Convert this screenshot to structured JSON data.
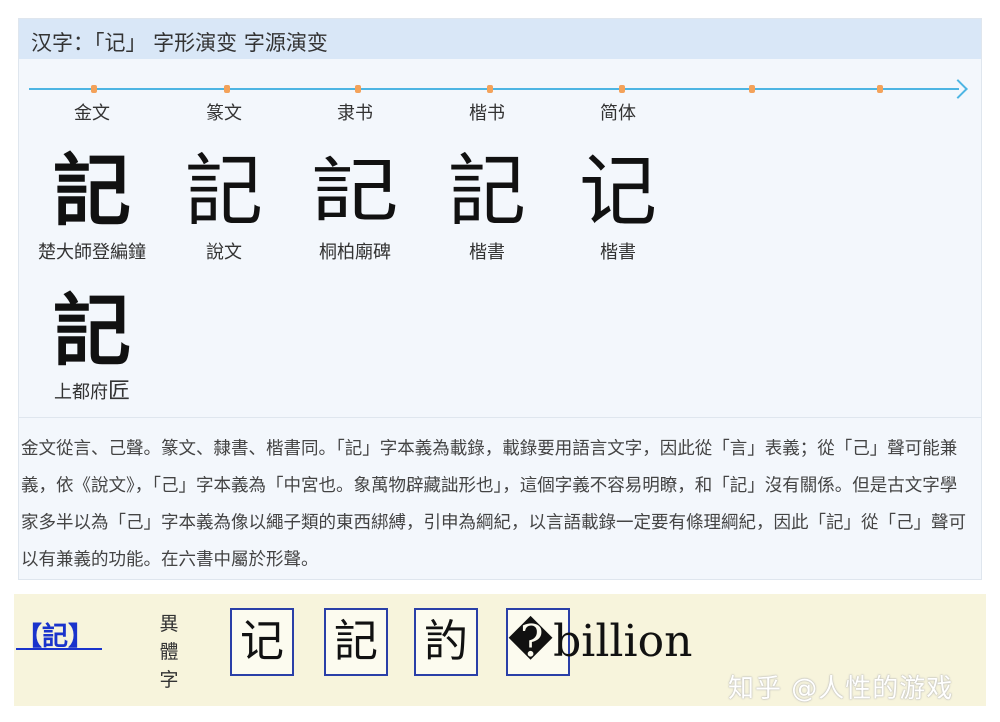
{
  "title": "汉字：「记」 字形演变 字源演变",
  "timeline": {
    "eras": [
      "金文",
      "篆文",
      "隶书",
      "楷书",
      "简体"
    ]
  },
  "forms": [
    {
      "glyph": "記",
      "source": "楚大師登編鐘"
    },
    {
      "glyph": "記",
      "source": "說文"
    },
    {
      "glyph": "記",
      "source": "桐柏廟碑"
    },
    {
      "glyph": "記",
      "source": "楷書"
    },
    {
      "glyph": "记",
      "source": "楷書"
    }
  ],
  "extra_form": {
    "glyph": "記",
    "source": "上都府",
    "source_suffix": "匠"
  },
  "description": "金文從言、己聲。篆文、隸書、楷書同。「記」字本義為載錄，載錄要用語言文字，因此從「言」表義；從「己」聲可能兼義，依《說文》，「己」字本義為「中宮也。象萬物辟藏詘形也」，這個字義不容易明瞭，和「記」沒有關係。但是古文字學家多半以為「己」字本義為像以繩子類的東西綁縛，引申為綱紀，以言語載錄一定要有條理綱紀，因此「記」從「己」聲可以有兼義的功能。在六書中屬於形聲。",
  "variants": {
    "title": "【記】",
    "label_chars": [
      "異",
      "體",
      "字"
    ],
    "chars": [
      "记",
      "記",
      "訋",
      "�billion"
    ]
  },
  "watermark": "知乎 @人性的游戏"
}
